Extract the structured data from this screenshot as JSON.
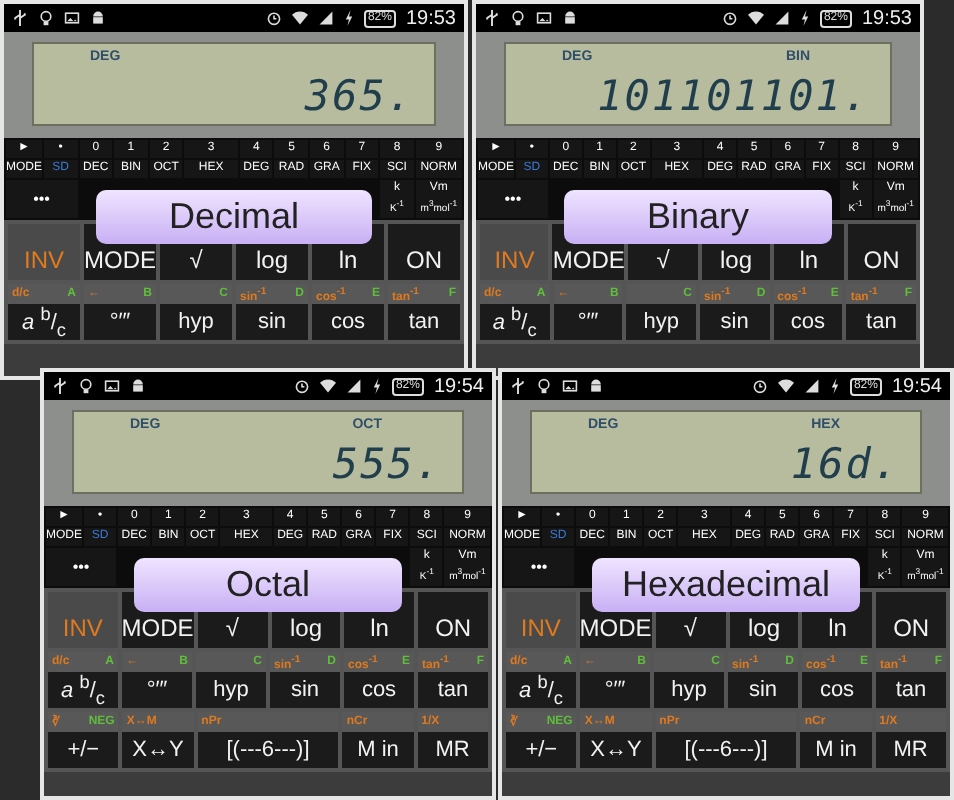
{
  "panels": [
    {
      "caption": "Decimal",
      "status": {
        "battery": "82%",
        "time": "19:53"
      },
      "display": {
        "angle": "DEG",
        "value": "365."
      },
      "function_keys": {
        "digits": [
          "►",
          "•",
          "0",
          "1",
          "2",
          "3",
          "4",
          "5",
          "6",
          "7",
          "8",
          "9"
        ],
        "modes": [
          {
            "label": "MODE",
            "color": "#ffffff"
          },
          {
            "label": "SD",
            "color": "#3a7bd5"
          },
          {
            "label": "DEC",
            "color": "#ffffff"
          },
          {
            "label": "BIN",
            "color": "#ffffff"
          },
          {
            "label": "OCT",
            "color": "#ffffff"
          },
          {
            "label": "HEX",
            "color": "#ffffff"
          },
          {
            "label": "DEG",
            "color": "#ffffff"
          },
          {
            "label": "RAD",
            "color": "#ffffff"
          },
          {
            "label": "GRA",
            "color": "#ffffff"
          },
          {
            "label": "FIX",
            "color": "#ffffff"
          },
          {
            "label": "SCI",
            "color": "#ffffff"
          },
          {
            "label": "NORM",
            "color": "#ffffff"
          }
        ],
        "units": [
          {
            "top": "•••"
          },
          {
            "top": "k",
            "bottom": "K$^{-1}$"
          },
          {
            "top": "Vm",
            "bottom": "m$^{3}$mol$^{-1}$"
          }
        ]
      },
      "keys": [
        [
          {
            "label": "INV",
            "kind": "accent"
          },
          {
            "label": "MODE",
            "kind": "normal"
          },
          {
            "label": "√",
            "kind": "normal"
          },
          {
            "label": "log",
            "kind": "normal"
          },
          {
            "label": "ln",
            "kind": "normal"
          },
          {
            "label": "ON",
            "kind": "normal"
          }
        ],
        [
          {
            "label": "*a* $^{b}$/$_{c}$",
            "kind": "normal",
            "shift": "d/c",
            "alpha": "A"
          },
          {
            "label": "°′″",
            "kind": "normal",
            "shift": "←",
            "alpha": "B"
          },
          {
            "label": "hyp",
            "kind": "normal",
            "alpha": "C"
          },
          {
            "label": "sin",
            "kind": "normal",
            "shift": "sin$^{-1}$",
            "alpha": "D"
          },
          {
            "label": "cos",
            "kind": "normal",
            "shift": "cos$^{-1}$",
            "alpha": "E"
          },
          {
            "label": "tan",
            "kind": "normal",
            "shift": "tan$^{-1}$",
            "alpha": "F"
          }
        ]
      ]
    },
    {
      "caption": "Binary",
      "status": {
        "battery": "82%",
        "time": "19:53"
      },
      "display": {
        "angle": "DEG",
        "base": "BIN",
        "value": "101101101."
      },
      "function_keys": {
        "digits": [
          "►",
          "•",
          "0",
          "1",
          "2",
          "3",
          "4",
          "5",
          "6",
          "7",
          "8",
          "9"
        ],
        "modes": [
          {
            "label": "MODE",
            "color": "#ffffff"
          },
          {
            "label": "SD",
            "color": "#3a7bd5"
          },
          {
            "label": "DEC",
            "color": "#ffffff"
          },
          {
            "label": "BIN",
            "color": "#ffffff"
          },
          {
            "label": "OCT",
            "color": "#ffffff"
          },
          {
            "label": "HEX",
            "color": "#ffffff"
          },
          {
            "label": "DEG",
            "color": "#ffffff"
          },
          {
            "label": "RAD",
            "color": "#ffffff"
          },
          {
            "label": "GRA",
            "color": "#ffffff"
          },
          {
            "label": "FIX",
            "color": "#ffffff"
          },
          {
            "label": "SCI",
            "color": "#ffffff"
          },
          {
            "label": "NORM",
            "color": "#ffffff"
          }
        ],
        "units": [
          {
            "top": "•••"
          },
          {
            "top": "k",
            "bottom": "K$^{-1}$"
          },
          {
            "top": "Vm",
            "bottom": "m$^{3}$mol$^{-1}$"
          }
        ]
      },
      "keys": [
        [
          {
            "label": "INV",
            "kind": "accent"
          },
          {
            "label": "MODE",
            "kind": "normal"
          },
          {
            "label": "√",
            "kind": "normal"
          },
          {
            "label": "log",
            "kind": "normal"
          },
          {
            "label": "ln",
            "kind": "normal"
          },
          {
            "label": "ON",
            "kind": "normal"
          }
        ],
        [
          {
            "label": "*a* $^{b}$/$_{c}$",
            "kind": "normal",
            "shift": "d/c",
            "alpha": "A"
          },
          {
            "label": "°′″",
            "kind": "normal",
            "shift": "←",
            "alpha": "B"
          },
          {
            "label": "hyp",
            "kind": "normal",
            "alpha": "C"
          },
          {
            "label": "sin",
            "kind": "normal",
            "shift": "sin$^{-1}$",
            "alpha": "D"
          },
          {
            "label": "cos",
            "kind": "normal",
            "shift": "cos$^{-1}$",
            "alpha": "E"
          },
          {
            "label": "tan",
            "kind": "normal",
            "shift": "tan$^{-1}$",
            "alpha": "F"
          }
        ]
      ]
    },
    {
      "caption": "Octal",
      "status": {
        "battery": "82%",
        "time": "19:54"
      },
      "display": {
        "angle": "DEG",
        "base": "OCT",
        "value": "555."
      },
      "function_keys": {
        "digits": [
          "►",
          "•",
          "0",
          "1",
          "2",
          "3",
          "4",
          "5",
          "6",
          "7",
          "8",
          "9"
        ],
        "modes": [
          {
            "label": "MODE",
            "color": "#ffffff"
          },
          {
            "label": "SD",
            "color": "#3a7bd5"
          },
          {
            "label": "DEC",
            "color": "#ffffff"
          },
          {
            "label": "BIN",
            "color": "#ffffff"
          },
          {
            "label": "OCT",
            "color": "#ffffff"
          },
          {
            "label": "HEX",
            "color": "#ffffff"
          },
          {
            "label": "DEG",
            "color": "#ffffff"
          },
          {
            "label": "RAD",
            "color": "#ffffff"
          },
          {
            "label": "GRA",
            "color": "#ffffff"
          },
          {
            "label": "FIX",
            "color": "#ffffff"
          },
          {
            "label": "SCI",
            "color": "#ffffff"
          },
          {
            "label": "NORM",
            "color": "#ffffff"
          }
        ],
        "units": [
          {
            "top": "•••"
          },
          {
            "top": "k",
            "bottom": "K$^{-1}$"
          },
          {
            "top": "Vm",
            "bottom": "m$^{3}$mol$^{-1}$"
          }
        ]
      },
      "keys": [
        [
          {
            "label": "INV",
            "kind": "accent"
          },
          {
            "label": "MODE",
            "kind": "normal"
          },
          {
            "label": "√",
            "kind": "normal"
          },
          {
            "label": "log",
            "kind": "normal"
          },
          {
            "label": "ln",
            "kind": "normal"
          },
          {
            "label": "ON",
            "kind": "normal"
          }
        ],
        [
          {
            "label": "*a* $^{b}$/$_{c}$",
            "kind": "normal",
            "shift": "d/c",
            "alpha": "A"
          },
          {
            "label": "°′″",
            "kind": "normal",
            "shift": "←",
            "alpha": "B"
          },
          {
            "label": "hyp",
            "kind": "normal",
            "alpha": "C"
          },
          {
            "label": "sin",
            "kind": "normal",
            "shift": "sin$^{-1}$",
            "alpha": "D"
          },
          {
            "label": "cos",
            "kind": "normal",
            "shift": "cos$^{-1}$",
            "alpha": "E"
          },
          {
            "label": "tan",
            "kind": "normal",
            "shift": "tan$^{-1}$",
            "alpha": "F"
          }
        ],
        [
          {
            "label": "+/−",
            "kind": "normal",
            "shift": "∛",
            "alpha": "NEG"
          },
          {
            "label": "X↔Y",
            "kind": "normal",
            "shift": "X↔M"
          },
          {
            "label": "[(---6---)]",
            "kind": "normal",
            "shift": "nPr"
          },
          {
            "label": "M in",
            "kind": "normal",
            "shift": "nCr"
          },
          {
            "label": "MR",
            "kind": "normal",
            "shift": "1/X"
          }
        ]
      ]
    },
    {
      "caption": "Hexadecimal",
      "status": {
        "battery": "82%",
        "time": "19:54"
      },
      "display": {
        "angle": "DEG",
        "base": "HEX",
        "value": "16d."
      },
      "function_keys": {
        "digits": [
          "►",
          "•",
          "0",
          "1",
          "2",
          "3",
          "4",
          "5",
          "6",
          "7",
          "8",
          "9"
        ],
        "modes": [
          {
            "label": "MODE",
            "color": "#ffffff"
          },
          {
            "label": "SD",
            "color": "#3a7bd5"
          },
          {
            "label": "DEC",
            "color": "#ffffff"
          },
          {
            "label": "BIN",
            "color": "#ffffff"
          },
          {
            "label": "OCT",
            "color": "#ffffff"
          },
          {
            "label": "HEX",
            "color": "#ffffff"
          },
          {
            "label": "DEG",
            "color": "#ffffff"
          },
          {
            "label": "RAD",
            "color": "#ffffff"
          },
          {
            "label": "GRA",
            "color": "#ffffff"
          },
          {
            "label": "FIX",
            "color": "#ffffff"
          },
          {
            "label": "SCI",
            "color": "#ffffff"
          },
          {
            "label": "NORM",
            "color": "#ffffff"
          }
        ],
        "units": [
          {
            "top": "•••"
          },
          {
            "top": "k",
            "bottom": "K$^{-1}$"
          },
          {
            "top": "Vm",
            "bottom": "m$^{3}$mol$^{-1}$"
          }
        ]
      },
      "keys": [
        [
          {
            "label": "INV",
            "kind": "accent"
          },
          {
            "label": "MODE",
            "kind": "normal"
          },
          {
            "label": "√",
            "kind": "normal"
          },
          {
            "label": "log",
            "kind": "normal"
          },
          {
            "label": "ln",
            "kind": "normal"
          },
          {
            "label": "ON",
            "kind": "normal"
          }
        ],
        [
          {
            "label": "*a* $^{b}$/$_{c}$",
            "kind": "normal",
            "shift": "d/c",
            "alpha": "A"
          },
          {
            "label": "°′″",
            "kind": "normal",
            "shift": "←",
            "alpha": "B"
          },
          {
            "label": "hyp",
            "kind": "normal",
            "alpha": "C"
          },
          {
            "label": "sin",
            "kind": "normal",
            "shift": "sin$^{-1}$",
            "alpha": "D"
          },
          {
            "label": "cos",
            "kind": "normal",
            "shift": "cos$^{-1}$",
            "alpha": "E"
          },
          {
            "label": "tan",
            "kind": "normal",
            "shift": "tan$^{-1}$",
            "alpha": "F"
          }
        ],
        [
          {
            "label": "+/−",
            "kind": "normal",
            "shift": "∛",
            "alpha": "NEG"
          },
          {
            "label": "X↔Y",
            "kind": "normal",
            "shift": "X↔M"
          },
          {
            "label": "[(---6---)]",
            "kind": "normal",
            "shift": "nPr"
          },
          {
            "label": "M in",
            "kind": "normal",
            "shift": "nCr"
          },
          {
            "label": "MR",
            "kind": "normal",
            "shift": "1/X"
          }
        ]
      ]
    }
  ]
}
